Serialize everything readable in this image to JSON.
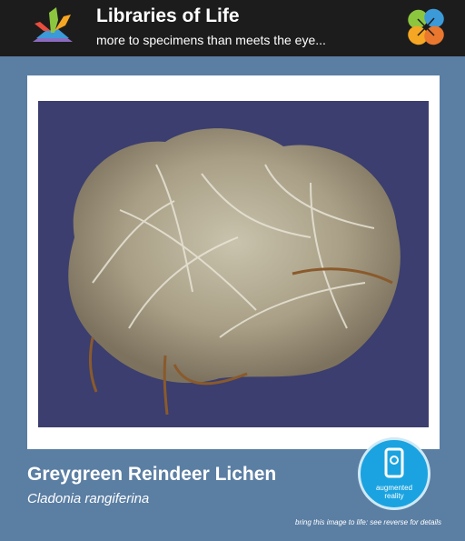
{
  "header": {
    "title": "Libraries of Life",
    "subtitle": "more to specimens than meets the eye..."
  },
  "specimen": {
    "common_name": "Greygreen Reindeer Lichen",
    "scientific_name": "Cladonia rangiferina"
  },
  "ar_badge": {
    "label_line1": "augmented",
    "label_line2": "reality",
    "icon": "phone-icon"
  },
  "footer": {
    "note": "bring this image to life: see reverse for details"
  },
  "colors": {
    "background": "#5b7ea3",
    "header": "#1c1c1c",
    "ar_blue": "#1aa3e0",
    "photo_backdrop": "#3b3e6e"
  }
}
